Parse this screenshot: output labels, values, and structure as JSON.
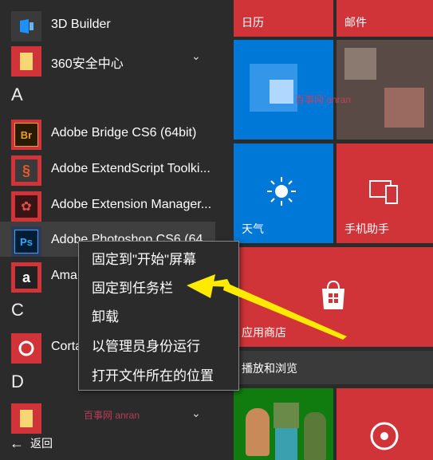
{
  "app_list": {
    "rows": [
      {
        "label": "3D Builder",
        "icon": "3d-builder-icon"
      },
      {
        "label": "360安全中心",
        "icon": "folder-icon"
      },
      {
        "label": "Adobe Bridge CS6 (64bit)",
        "icon_text": "Br"
      },
      {
        "label": "Adobe ExtendScript Toolki...",
        "icon": "extendscript-icon"
      },
      {
        "label": "Adobe Extension Manager...",
        "icon": "extension-manager-icon"
      },
      {
        "label": "Adobe Photoshop CS6 (64",
        "icon_text": "Ps"
      },
      {
        "label": "Ama",
        "icon_text": "a"
      },
      {
        "label": "Corta",
        "icon": "cortana-icon"
      }
    ],
    "letters": [
      "A",
      "C",
      "D"
    ],
    "back_label": "返回"
  },
  "tiles": {
    "calendar": "日历",
    "mail": "邮件",
    "weather": "天气",
    "phone_companion": "手机助手",
    "store": "应用商店",
    "edge_partial": "播放和浏览"
  },
  "context_menu": {
    "items": [
      "固定到\"开始\"屏幕",
      "固定到任务栏",
      "卸载",
      "以管理员身份运行",
      "打开文件所在的位置"
    ]
  },
  "watermark": "百事网 anran",
  "colors": {
    "tile_red": "#d13438",
    "tile_blue": "#0078d7",
    "tile_green": "#107c10",
    "bg": "#2b2b2b",
    "arrow": "#ffea00"
  }
}
